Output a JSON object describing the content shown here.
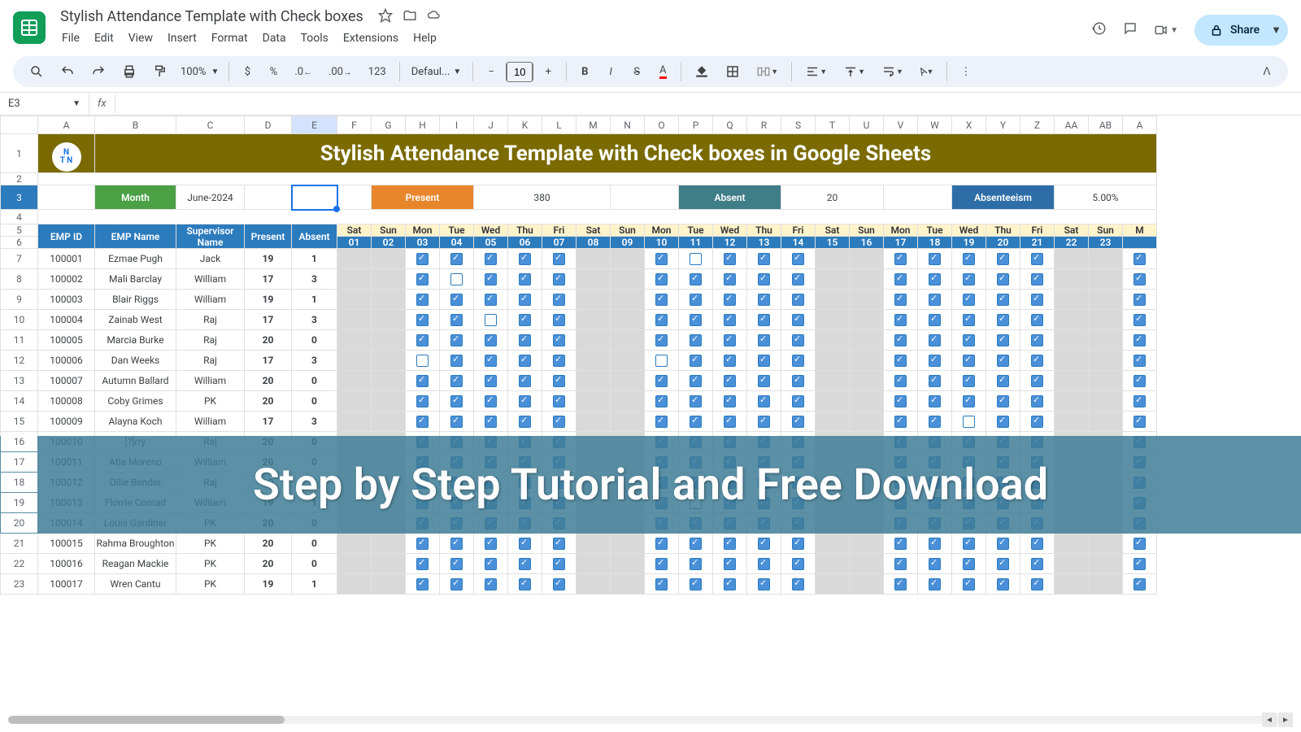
{
  "doc_title": "Stylish Attendance Template with Check boxes",
  "menus": [
    "File",
    "Edit",
    "View",
    "Insert",
    "Format",
    "Data",
    "Tools",
    "Extensions",
    "Help"
  ],
  "share_label": "Share",
  "toolbar": {
    "zoom": "100%",
    "font": "Defaul...",
    "font_size": "10"
  },
  "name_box": "E3",
  "banner": "Stylish Attendance Template with Check boxes in Google Sheets",
  "logo_text": "NTN",
  "stats": {
    "month_l": "Month",
    "month_v": "June-2024",
    "present_l": "Present",
    "present_v": "380",
    "absent_l": "Absent",
    "absent_v": "20",
    "abs_l": "Absenteeism",
    "abs_v": "5.00%"
  },
  "headers": {
    "emp_id": "EMP ID",
    "emp_name": "EMP Name",
    "supervisor": "Supervisor Name",
    "present": "Present",
    "absent": "Absent"
  },
  "col_letters": [
    "A",
    "B",
    "C",
    "D",
    "E",
    "F",
    "G",
    "H",
    "I",
    "J",
    "K",
    "L",
    "M",
    "N",
    "O",
    "P",
    "Q",
    "R",
    "S",
    "T",
    "U",
    "V",
    "W",
    "X",
    "Y",
    "Z",
    "AA",
    "AB",
    "A"
  ],
  "row_numbers": [
    "1",
    "2",
    "3",
    "4",
    "5",
    "6",
    "7",
    "8",
    "9",
    "10",
    "11",
    "12",
    "13",
    "14",
    "15",
    "16",
    "17",
    "18",
    "19",
    "20",
    "21",
    "22",
    "23"
  ],
  "days": [
    {
      "n": "Sat",
      "d": "01",
      "grey": true
    },
    {
      "n": "Sun",
      "d": "02",
      "grey": true
    },
    {
      "n": "Mon",
      "d": "03"
    },
    {
      "n": "Tue",
      "d": "04"
    },
    {
      "n": "Wed",
      "d": "05"
    },
    {
      "n": "Thu",
      "d": "06"
    },
    {
      "n": "Fri",
      "d": "07"
    },
    {
      "n": "Sat",
      "d": "08",
      "grey": true
    },
    {
      "n": "Sun",
      "d": "09",
      "grey": true
    },
    {
      "n": "Mon",
      "d": "10"
    },
    {
      "n": "Tue",
      "d": "11"
    },
    {
      "n": "Wed",
      "d": "12"
    },
    {
      "n": "Thu",
      "d": "13"
    },
    {
      "n": "Fri",
      "d": "14"
    },
    {
      "n": "Sat",
      "d": "15",
      "grey": true
    },
    {
      "n": "Sun",
      "d": "16",
      "grey": true
    },
    {
      "n": "Mon",
      "d": "17"
    },
    {
      "n": "Tue",
      "d": "18"
    },
    {
      "n": "Wed",
      "d": "19"
    },
    {
      "n": "Thu",
      "d": "20"
    },
    {
      "n": "Fri",
      "d": "21"
    },
    {
      "n": "Sat",
      "d": "22",
      "grey": true
    },
    {
      "n": "Sun",
      "d": "23",
      "grey": true
    },
    {
      "n": "M",
      "d": ""
    }
  ],
  "rows": [
    {
      "id": "100001",
      "name": "Ezmae Pugh",
      "sup": "Jack",
      "p": "19",
      "a": "1",
      "cb": [
        null,
        null,
        1,
        1,
        1,
        1,
        1,
        null,
        null,
        1,
        0,
        1,
        1,
        1,
        null,
        null,
        1,
        1,
        1,
        1,
        1,
        null,
        null,
        1
      ]
    },
    {
      "id": "100002",
      "name": "Mali Barclay",
      "sup": "William",
      "p": "17",
      "a": "3",
      "cb": [
        null,
        null,
        1,
        0,
        1,
        1,
        1,
        null,
        null,
        1,
        1,
        1,
        1,
        1,
        null,
        null,
        1,
        1,
        1,
        1,
        1,
        null,
        null,
        1
      ]
    },
    {
      "id": "100003",
      "name": "Blair Riggs",
      "sup": "William",
      "p": "19",
      "a": "1",
      "cb": [
        null,
        null,
        1,
        1,
        1,
        1,
        1,
        null,
        null,
        1,
        1,
        1,
        1,
        1,
        null,
        null,
        1,
        1,
        1,
        1,
        1,
        null,
        null,
        1
      ]
    },
    {
      "id": "100004",
      "name": "Zainab West",
      "sup": "Raj",
      "p": "17",
      "a": "3",
      "cb": [
        null,
        null,
        1,
        1,
        0,
        1,
        1,
        null,
        null,
        1,
        1,
        1,
        1,
        1,
        null,
        null,
        1,
        1,
        1,
        1,
        1,
        null,
        null,
        1
      ]
    },
    {
      "id": "100005",
      "name": "Marcia Burke",
      "sup": "Raj",
      "p": "20",
      "a": "0",
      "cb": [
        null,
        null,
        1,
        1,
        1,
        1,
        1,
        null,
        null,
        1,
        1,
        1,
        1,
        1,
        null,
        null,
        1,
        1,
        1,
        1,
        1,
        null,
        null,
        1
      ]
    },
    {
      "id": "100006",
      "name": "Dan Weeks",
      "sup": "Raj",
      "p": "17",
      "a": "3",
      "cb": [
        null,
        null,
        0,
        1,
        1,
        1,
        1,
        null,
        null,
        0,
        1,
        1,
        1,
        1,
        null,
        null,
        1,
        1,
        1,
        1,
        1,
        null,
        null,
        1
      ]
    },
    {
      "id": "100007",
      "name": "Autumn Ballard",
      "sup": "William",
      "p": "20",
      "a": "0",
      "cb": [
        null,
        null,
        1,
        1,
        1,
        1,
        1,
        null,
        null,
        1,
        1,
        1,
        1,
        1,
        null,
        null,
        1,
        1,
        1,
        1,
        1,
        null,
        null,
        1
      ]
    },
    {
      "id": "100008",
      "name": "Coby Grimes",
      "sup": "PK",
      "p": "20",
      "a": "0",
      "cb": [
        null,
        null,
        1,
        1,
        1,
        1,
        1,
        null,
        null,
        1,
        1,
        1,
        1,
        1,
        null,
        null,
        1,
        1,
        1,
        1,
        1,
        null,
        null,
        1
      ]
    },
    {
      "id": "100009",
      "name": "Alayna Koch",
      "sup": "William",
      "p": "17",
      "a": "3",
      "cb": [
        null,
        null,
        1,
        1,
        1,
        1,
        1,
        null,
        null,
        1,
        1,
        1,
        1,
        1,
        null,
        null,
        1,
        1,
        0,
        1,
        1,
        null,
        null,
        1
      ]
    },
    {
      "id": "100010",
      "name": "[?]rry",
      "sup": "Raj",
      "p": "20",
      "a": "0",
      "cb": [
        null,
        null,
        1,
        1,
        1,
        1,
        1,
        null,
        null,
        1,
        1,
        1,
        1,
        1,
        null,
        null,
        1,
        1,
        1,
        1,
        1,
        null,
        null,
        1
      ]
    },
    {
      "id": "100011",
      "name": "Atla Moreno",
      "sup": "William",
      "p": "20",
      "a": "0",
      "cb": [
        null,
        null,
        1,
        1,
        1,
        1,
        1,
        null,
        null,
        1,
        1,
        1,
        1,
        1,
        null,
        null,
        1,
        1,
        1,
        1,
        1,
        null,
        null,
        1
      ]
    },
    {
      "id": "100012",
      "name": "Ollie Bender",
      "sup": "Raj",
      "p": "19",
      "a": "1",
      "cb": [
        null,
        null,
        1,
        1,
        1,
        1,
        1,
        null,
        null,
        1,
        1,
        1,
        1,
        1,
        null,
        null,
        1,
        1,
        1,
        1,
        1,
        null,
        null,
        1
      ]
    },
    {
      "id": "100013",
      "name": "Florrie Conrad",
      "sup": "William",
      "p": "19",
      "a": "1",
      "cb": [
        null,
        null,
        1,
        1,
        1,
        1,
        1,
        null,
        null,
        1,
        0,
        1,
        1,
        1,
        null,
        null,
        1,
        1,
        1,
        1,
        1,
        null,
        null,
        1
      ]
    },
    {
      "id": "100014",
      "name": "Louis Gardiner",
      "sup": "PK",
      "p": "20",
      "a": "0",
      "cb": [
        null,
        null,
        1,
        1,
        1,
        1,
        1,
        null,
        null,
        1,
        1,
        1,
        1,
        1,
        null,
        null,
        1,
        1,
        1,
        1,
        1,
        null,
        null,
        1
      ]
    },
    {
      "id": "100015",
      "name": "Rahma Broughton",
      "sup": "PK",
      "p": "20",
      "a": "0",
      "cb": [
        null,
        null,
        1,
        1,
        1,
        1,
        1,
        null,
        null,
        1,
        1,
        1,
        1,
        1,
        null,
        null,
        1,
        1,
        1,
        1,
        1,
        null,
        null,
        1
      ]
    },
    {
      "id": "100016",
      "name": "Reagan Mackie",
      "sup": "PK",
      "p": "20",
      "a": "0",
      "cb": [
        null,
        null,
        1,
        1,
        1,
        1,
        1,
        null,
        null,
        1,
        1,
        1,
        1,
        1,
        null,
        null,
        1,
        1,
        1,
        1,
        1,
        null,
        null,
        1
      ]
    },
    {
      "id": "100017",
      "name": "Wren Cantu",
      "sup": "PK",
      "p": "19",
      "a": "1",
      "cb": [
        null,
        null,
        1,
        1,
        1,
        1,
        1,
        null,
        null,
        1,
        1,
        1,
        1,
        1,
        null,
        null,
        1,
        1,
        1,
        1,
        1,
        null,
        null,
        1
      ]
    }
  ],
  "overlay_text": "Step by Step Tutorial and Free Download"
}
